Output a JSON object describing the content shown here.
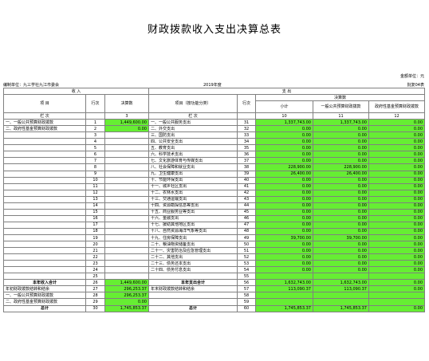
{
  "title": "财政拨款收入支出决算总表",
  "unit_label": "金额单位：元",
  "org_label": "编制单位：九三学社九江市委会",
  "year_label": "2019年度",
  "form_code": "批复04表",
  "header": {
    "income": "收    入",
    "expense": "支    出",
    "item": "项    目",
    "row_no": "行次",
    "budget": "决算数",
    "item_func": "项目（按功能分类）",
    "settle": "决算数",
    "subtotal": "小计",
    "gen_budget": "一般公共预算财政拨款",
    "gov_fund": "政府性基金预算财政拨款",
    "lanci": "栏    次",
    "col3": "3",
    "col10": "10",
    "col11": "11",
    "col12": "12"
  },
  "rows": [
    {
      "li": "一、一般公共预算财政拨款",
      "ln": "1",
      "lv": "1,449,600.00",
      "ri": "一、一般公共服务支出",
      "rn": "31",
      "s": "1,337,743.00",
      "g": "1,337,743.00",
      "f": "0.00"
    },
    {
      "li": "二、政府性基金预算财政拨款",
      "ln": "2",
      "lv": "0.00",
      "ri": "二、外交支出",
      "rn": "32",
      "s": "0.00",
      "g": "0.00",
      "f": "0.00"
    },
    {
      "li": "",
      "ln": "3",
      "lv": "",
      "ri": "三、国防支出",
      "rn": "33",
      "s": "0.00",
      "g": "0.00",
      "f": "0.00"
    },
    {
      "li": "",
      "ln": "4",
      "lv": "",
      "ri": "四、公共安全支出",
      "rn": "34",
      "s": "0.00",
      "g": "0.00",
      "f": "0.00"
    },
    {
      "li": "",
      "ln": "5",
      "lv": "",
      "ri": "五、教育支出",
      "rn": "35",
      "s": "0.00",
      "g": "0.00",
      "f": "0.00"
    },
    {
      "li": "",
      "ln": "6",
      "lv": "",
      "ri": "六、科学技术支出",
      "rn": "36",
      "s": "0.00",
      "g": "0.00",
      "f": "0.00"
    },
    {
      "li": "",
      "ln": "7",
      "lv": "",
      "ri": "七、文化旅游体育与传媒支出",
      "rn": "37",
      "s": "0.00",
      "g": "0.00",
      "f": "0.00"
    },
    {
      "li": "",
      "ln": "8",
      "lv": "",
      "ri": "八、社会保障和就业支出",
      "rn": "38",
      "s": "228,900.00",
      "g": "228,900.00",
      "f": "0.00"
    },
    {
      "li": "",
      "ln": "9",
      "lv": "",
      "ri": "九、卫生健康支出",
      "rn": "39",
      "s": "26,400.00",
      "g": "26,400.00",
      "f": "0.00"
    },
    {
      "li": "",
      "ln": "10",
      "lv": "",
      "ri": "十、节能环保支出",
      "rn": "40",
      "s": "0.00",
      "g": "0.00",
      "f": "0.00"
    },
    {
      "li": "",
      "ln": "11",
      "lv": "",
      "ri": "十一、城乡社区支出",
      "rn": "41",
      "s": "0.00",
      "g": "0.00",
      "f": "0.00"
    },
    {
      "li": "",
      "ln": "12",
      "lv": "",
      "ri": "十二、农林水支出",
      "rn": "42",
      "s": "0.00",
      "g": "0.00",
      "f": "0.00"
    },
    {
      "li": "",
      "ln": "13",
      "lv": "",
      "ri": "十三、交通运输支出",
      "rn": "43",
      "s": "0.00",
      "g": "0.00",
      "f": "0.00"
    },
    {
      "li": "",
      "ln": "14",
      "lv": "",
      "ri": "十四、资源勘探信息等支出",
      "rn": "44",
      "s": "0.00",
      "g": "0.00",
      "f": "0.00"
    },
    {
      "li": "",
      "ln": "15",
      "lv": "",
      "ri": "十五、商业服务业等支出",
      "rn": "45",
      "s": "0.00",
      "g": "0.00",
      "f": "0.00"
    },
    {
      "li": "",
      "ln": "16",
      "lv": "",
      "ri": "十六、金融支出",
      "rn": "46",
      "s": "0.00",
      "g": "0.00",
      "f": "0.00"
    },
    {
      "li": "",
      "ln": "17",
      "lv": "",
      "ri": "十七、援助其他地区支出",
      "rn": "47",
      "s": "0.00",
      "g": "0.00",
      "f": "0.00"
    },
    {
      "li": "",
      "ln": "18",
      "lv": "",
      "ri": "十八、自然资源海洋气象等支出",
      "rn": "48",
      "s": "0.00",
      "g": "0.00",
      "f": "0.00"
    },
    {
      "li": "",
      "ln": "19",
      "lv": "",
      "ri": "十九、住房保障支出",
      "rn": "49",
      "s": "39,700.00",
      "g": "39,700.00",
      "f": "0.00"
    },
    {
      "li": "",
      "ln": "20",
      "lv": "",
      "ri": "二十、粮油物资储备支出",
      "rn": "50",
      "s": "0.00",
      "g": "0.00",
      "f": "0.00"
    },
    {
      "li": "",
      "ln": "21",
      "lv": "",
      "ri": "二十一、灾害防治及应急管理支出",
      "rn": "51",
      "s": "0.00",
      "g": "0.00",
      "f": "0.00"
    },
    {
      "li": "",
      "ln": "22",
      "lv": "",
      "ri": "二十二、其他支出",
      "rn": "52",
      "s": "0.00",
      "g": "0.00",
      "f": "0.00"
    },
    {
      "li": "",
      "ln": "23",
      "lv": "",
      "ri": "二十三、债务还本支出",
      "rn": "53",
      "s": "0.00",
      "g": "0.00",
      "f": "0.00"
    },
    {
      "li": "",
      "ln": "24",
      "lv": "",
      "ri": "二十四、债务付息支出",
      "rn": "54",
      "s": "0.00",
      "g": "0.00",
      "f": "0.00"
    },
    {
      "li": "",
      "ln": "25",
      "lv": "",
      "ri": "",
      "rn": "55",
      "s": "",
      "g": "",
      "f": ""
    },
    {
      "li": "本年收入合计",
      "ln": "26",
      "lv": "1,449,600.00",
      "ri": "本年支出合计",
      "rn": "56",
      "s": "1,632,743.00",
      "g": "1,632,743.00",
      "f": "0.00",
      "bold": true
    },
    {
      "li": "年初财政拨款结转和结余",
      "ln": "27",
      "lv": "296,253.37",
      "ri": "年末财政拨款结转和结余",
      "rn": "57",
      "s": "113,090.37",
      "g": "113,090.37",
      "f": "0.00"
    },
    {
      "li": "一、一般公共预算财政拨款",
      "ln": "28",
      "lv": "296,253.37",
      "ri": "",
      "rn": "58",
      "s": "",
      "g": "",
      "f": ""
    },
    {
      "li": "二、政府性基金预算财政拨款",
      "ln": "29",
      "lv": "0.00",
      "ri": "",
      "rn": "59",
      "s": "",
      "g": "",
      "f": ""
    },
    {
      "li": "总计",
      "ln": "30",
      "lv": "1,745,853.37",
      "ri": "总计",
      "rn": "60",
      "s": "1,745,853.37",
      "g": "1,745,853.37",
      "f": "0.00",
      "bold": true
    }
  ]
}
